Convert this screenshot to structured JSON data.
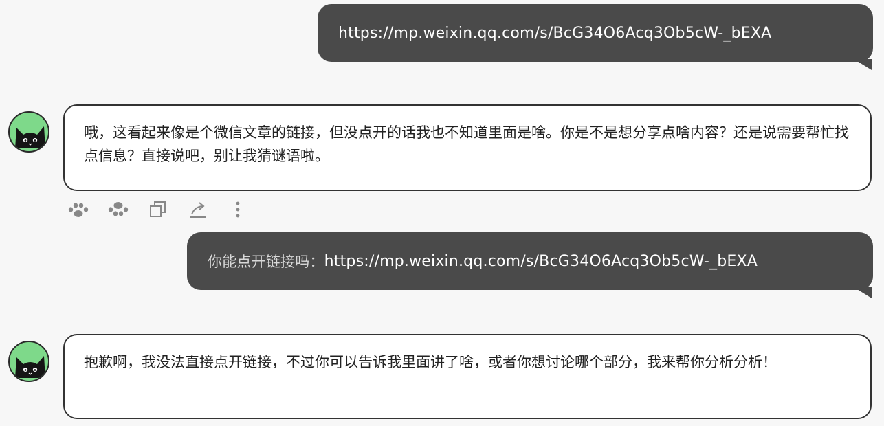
{
  "messages": [
    {
      "role": "user",
      "text": "https://mp.weixin.qq.com/s/BcG34O6Acq3Ob5cW-_bEXA"
    },
    {
      "role": "assistant",
      "text": "哦，这看起来像是个微信文章的链接，但没点开的话我也不知道里面是啥。你是不是想分享点啥内容？还是说需要帮忙找点信息？直接说吧，别让我猜谜语啦。"
    },
    {
      "role": "user",
      "prefix": "你能点开链接吗：",
      "text": "https://mp.weixin.qq.com/s/BcG34O6Acq3Ob5cW-_bEXA"
    },
    {
      "role": "assistant",
      "text": "抱歉啊，我没法直接点开链接，不过你可以告诉我里面讲了啥，或者你想讨论哪个部分，我来帮你分析分析！"
    }
  ],
  "actions": [
    {
      "icon": "paw-like-icon"
    },
    {
      "icon": "paw-dislike-icon"
    },
    {
      "icon": "copy-icon"
    },
    {
      "icon": "share-icon"
    },
    {
      "icon": "more-vertical-icon"
    }
  ],
  "colors": {
    "user_bubble": "#4a4a4a",
    "avatar_bg": "#7ed98a",
    "page_bg": "#f7f7f7"
  }
}
